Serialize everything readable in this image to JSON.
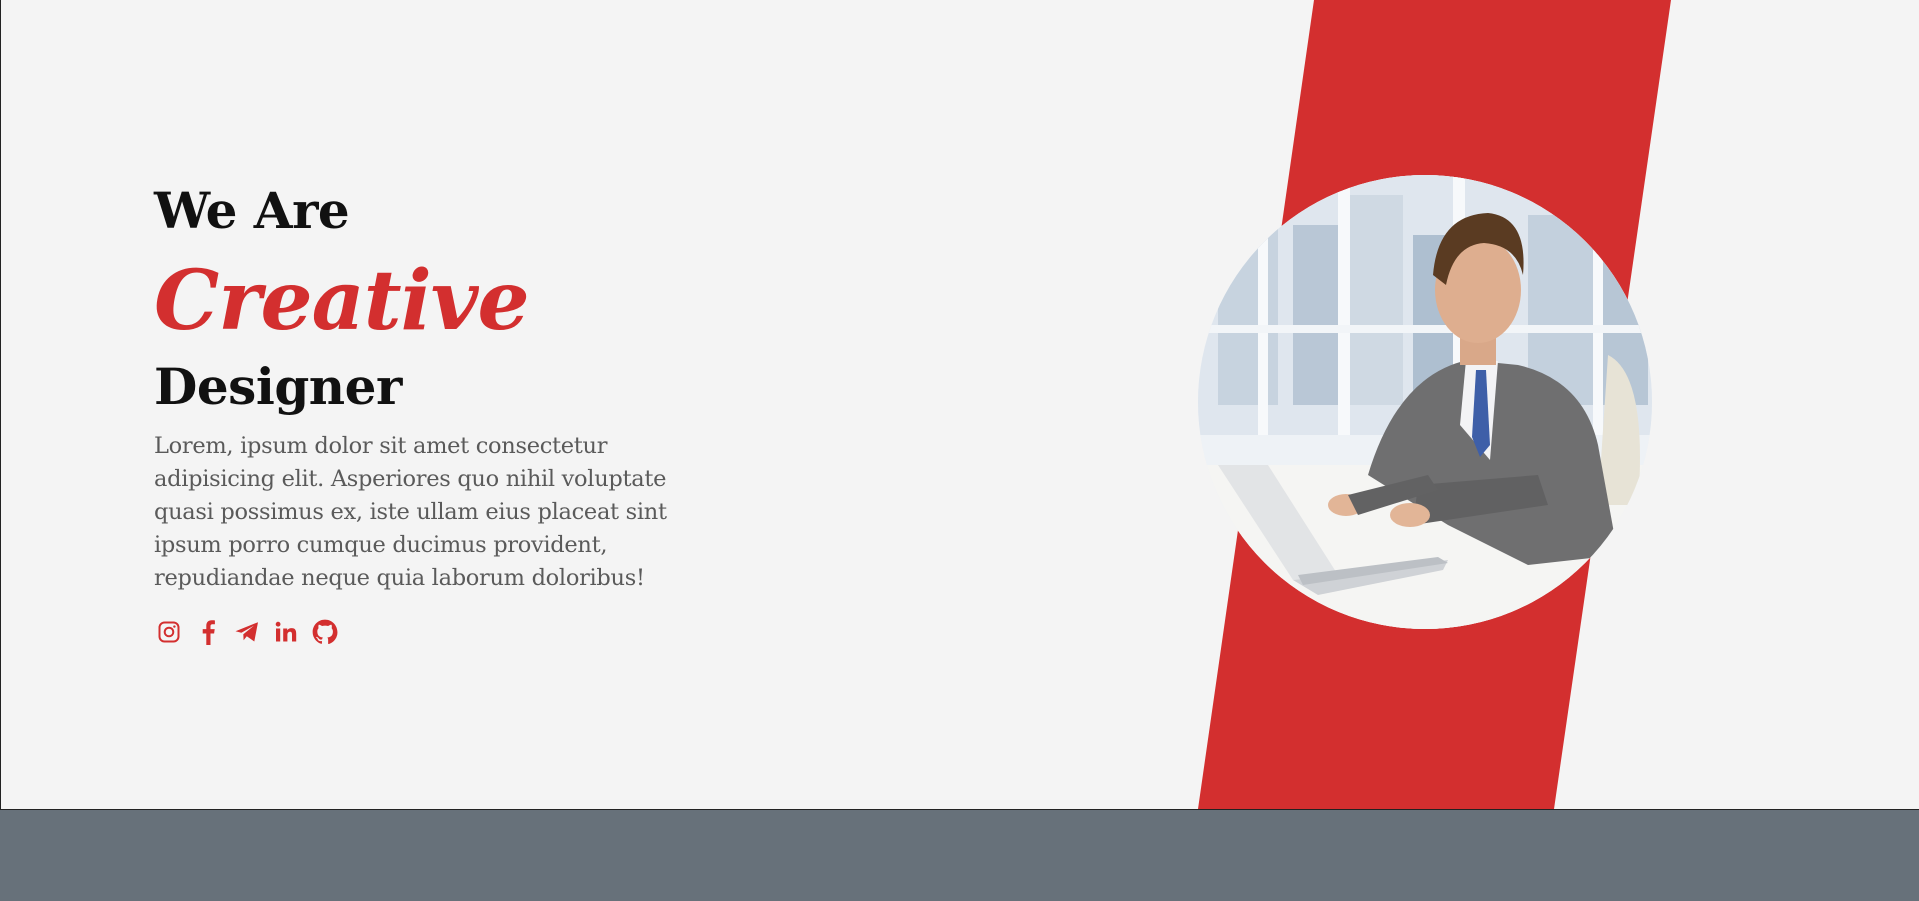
{
  "colors": {
    "accent": "#d32f2f",
    "background": "#f4f4f4",
    "footer": "#67717a",
    "heading": "#111111",
    "body_text": "#5a5a5a"
  },
  "hero": {
    "line1": "We Are",
    "line2": "Creative",
    "line3": "Designer",
    "description": "Lorem, ipsum dolor sit amet consectetur adipisicing elit. Asperiores quo nihil voluptate quasi possimus ex, iste ullam eius placeat sint ipsum porro cumque ducimus provident, repudiandae neque quia laborum doloribus!"
  },
  "socials": [
    {
      "icon": "instagram-icon"
    },
    {
      "icon": "facebook-icon"
    },
    {
      "icon": "telegram-icon"
    },
    {
      "icon": "linkedin-icon"
    },
    {
      "icon": "github-icon"
    }
  ],
  "photo": {
    "subject": "man in grey suit typing on laptop"
  }
}
